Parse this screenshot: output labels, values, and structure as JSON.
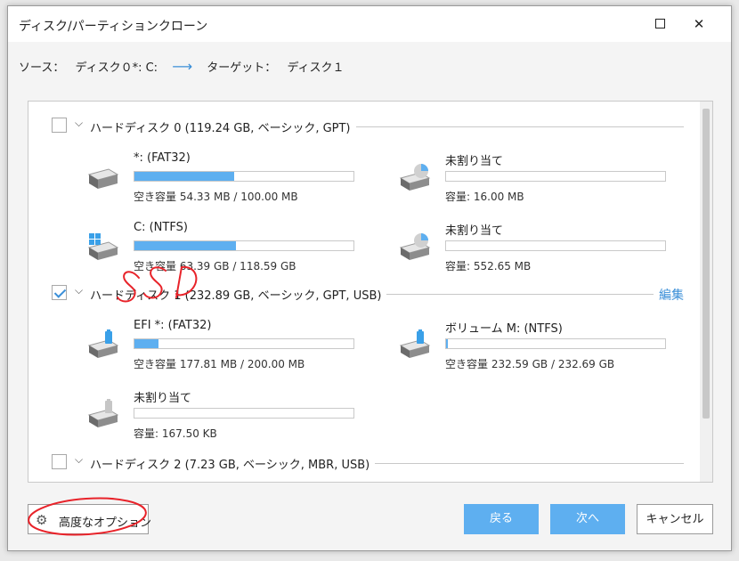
{
  "dialog": {
    "title": "ディスク/パーティションクローン",
    "maximize_icon": "maximize-icon",
    "close_glyph": "✕"
  },
  "source_bar": {
    "source_label": "ソース：",
    "source_value": "ディスク０*: C:",
    "arrow": "⟶",
    "target_label": "ターゲット：",
    "target_value": "ディスク１"
  },
  "disks": [
    {
      "label": "ハードディスク 0 (119.24 GB, ベーシック, GPT)",
      "checked": false,
      "partitions": [
        {
          "name": "*: (FAT32)",
          "capacity": "空き容量 54.33 MB / 100.00 MB",
          "fill": 0.457,
          "icon": "drive-icon"
        },
        {
          "name": "未割り当て",
          "capacity": "容量: 16.00 MB",
          "fill": 0,
          "icon": "unallocated-pie-icon"
        },
        {
          "name": "C: (NTFS)",
          "capacity": "空き容量 63.39 GB / 118.59 GB",
          "fill": 0.465,
          "icon": "windows-drive-icon"
        },
        {
          "name": "未割り当て",
          "capacity": "容量: 552.65 MB",
          "fill": 0,
          "icon": "unallocated-pie-icon"
        }
      ]
    },
    {
      "label": "ハードディスク 1 (232.89 GB, ベーシック, GPT, USB)",
      "checked": true,
      "edit_label": "編集",
      "partitions": [
        {
          "name": "EFI *: (FAT32)",
          "capacity": "空き容量 177.81 MB / 200.00 MB",
          "fill": 0.111,
          "icon": "usb-drive-icon"
        },
        {
          "name": "ボリューム M: (NTFS)",
          "capacity": "空き容量 232.59 GB / 232.69 GB",
          "fill": 0.004,
          "icon": "usb-drive-icon"
        },
        {
          "name": "未割り当て",
          "capacity": "容量: 167.50 KB",
          "fill": 0,
          "icon": "usb-drive-gray-icon"
        }
      ]
    },
    {
      "label": "ハードディスク 2 (7.23 GB, ベーシック, MBR, USB)",
      "checked": false,
      "partitions": []
    }
  ],
  "footer": {
    "advanced_options": "高度なオプション",
    "back": "戻る",
    "next": "次へ",
    "cancel": "キャンセル"
  },
  "annotation": {
    "handwritten_text": "SSD",
    "color": "#e8232a"
  },
  "colors": {
    "accent": "#5eaff0",
    "link": "#3b8fd8"
  }
}
